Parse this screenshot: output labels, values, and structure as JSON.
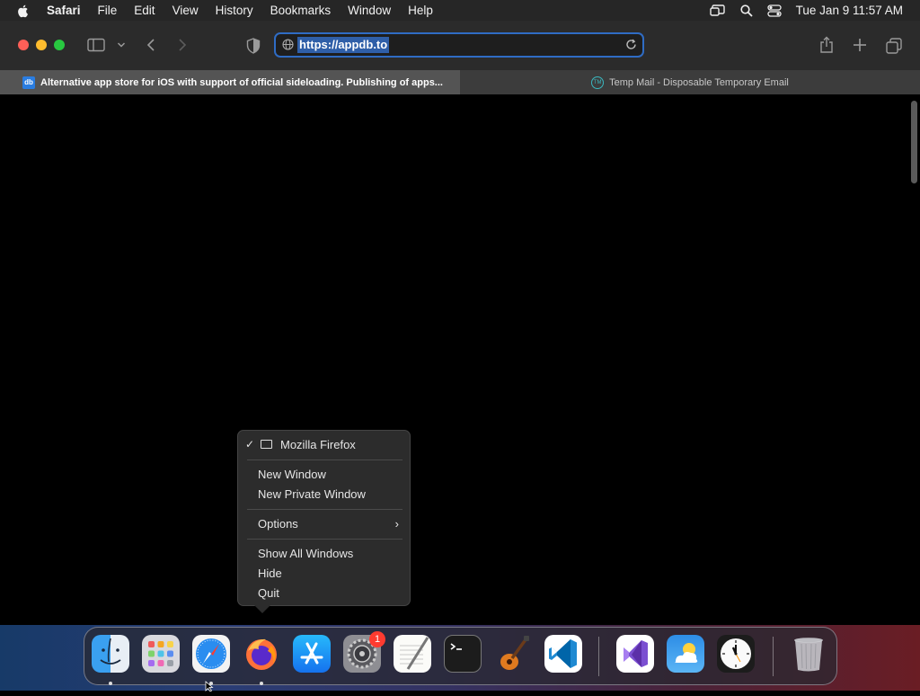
{
  "menubar": {
    "app_name": "Safari",
    "items": [
      "File",
      "Edit",
      "View",
      "History",
      "Bookmarks",
      "Window",
      "Help"
    ],
    "clock": "Tue Jan 9  11:57 AM"
  },
  "toolbar": {
    "url": "https://appdb.to"
  },
  "tabs": [
    {
      "favicon_text": "db",
      "title": "Alternative app store for iOS with support of official sideloading. Publishing of apps..."
    },
    {
      "favicon_text": "TM",
      "title": "Temp Mail - Disposable Temporary Email"
    }
  ],
  "context_menu": {
    "window_title": "Mozilla Firefox",
    "new_window": "New Window",
    "new_private_window": "New Private Window",
    "options": "Options",
    "show_all_windows": "Show All Windows",
    "hide": "Hide",
    "quit": "Quit"
  },
  "dock": {
    "settings_badge": "1",
    "apps": [
      "finder-icon",
      "launchpad-icon",
      "safari-icon",
      "firefox-icon",
      "app-store-icon",
      "system-settings-icon",
      "textedit-icon",
      "terminal-icon",
      "garageband-icon",
      "vscode-icon",
      "visual-studio-icon",
      "weather-icon",
      "clock-icon",
      "trash-icon"
    ]
  },
  "colors": {
    "accent": "#2f6cc4",
    "badge": "#ff3b30"
  }
}
